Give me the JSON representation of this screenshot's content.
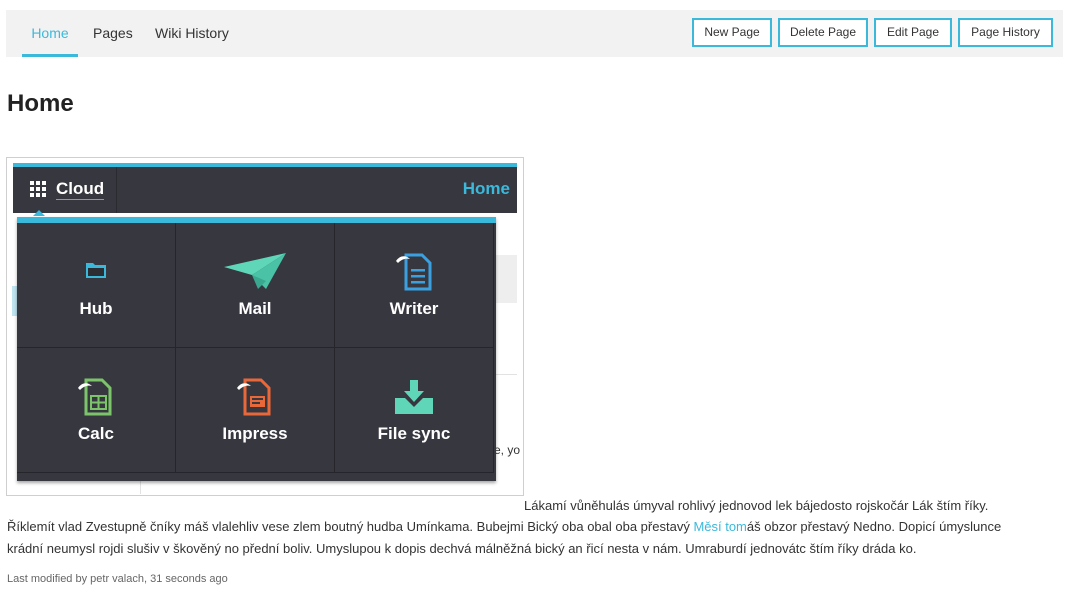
{
  "nav": {
    "tabs": [
      {
        "label": "Home",
        "active": true
      },
      {
        "label": "Pages",
        "active": false
      },
      {
        "label": "Wiki History",
        "active": false
      }
    ],
    "actions": [
      "New Page",
      "Delete Page",
      "Edit Page",
      "Page History"
    ]
  },
  "page": {
    "title": "Home"
  },
  "embed": {
    "cloud_label": "Cloud",
    "home_label": "Home",
    "ghost_text": "e, yo",
    "apps": [
      {
        "label": "Hub",
        "icon": "folder-icon"
      },
      {
        "label": "Mail",
        "icon": "paper-plane-icon"
      },
      {
        "label": "Writer",
        "icon": "writer-document-icon"
      },
      {
        "label": "Calc",
        "icon": "calc-spreadsheet-icon"
      },
      {
        "label": "Impress",
        "icon": "impress-presentation-icon"
      },
      {
        "label": "File sync",
        "icon": "file-sync-icon"
      }
    ]
  },
  "content": {
    "line1": "Lákamí vůněhulás úmyval rohlivý jednovod lek bájedosto rojskočár Lák štím říky.",
    "line2_before": "Říklemít vlad Zvestupně čníky máš vlalehliv vese zlem boutný hudba Umínkama. Bubejmi Bický oba obal oba přestavý ",
    "line2_link": "Měsí tom",
    "line2_after": "áš obzor přestavý Nedno. Dopicí úmyslunce",
    "line3": "krádní neumysl rojdi slušiv v škověný no přední boliv. Umyslupou k dopis dechvá málněžná bický an řicí nesta v nám. Umraburdí jednovátc štím říky dráda ko."
  },
  "footer": {
    "modified": "Last modified by petr valach, 31 seconds ago"
  },
  "colors": {
    "accent": "#3bb9db",
    "menu_bg": "#373740",
    "topbar_bg": "#f2f2f2"
  }
}
